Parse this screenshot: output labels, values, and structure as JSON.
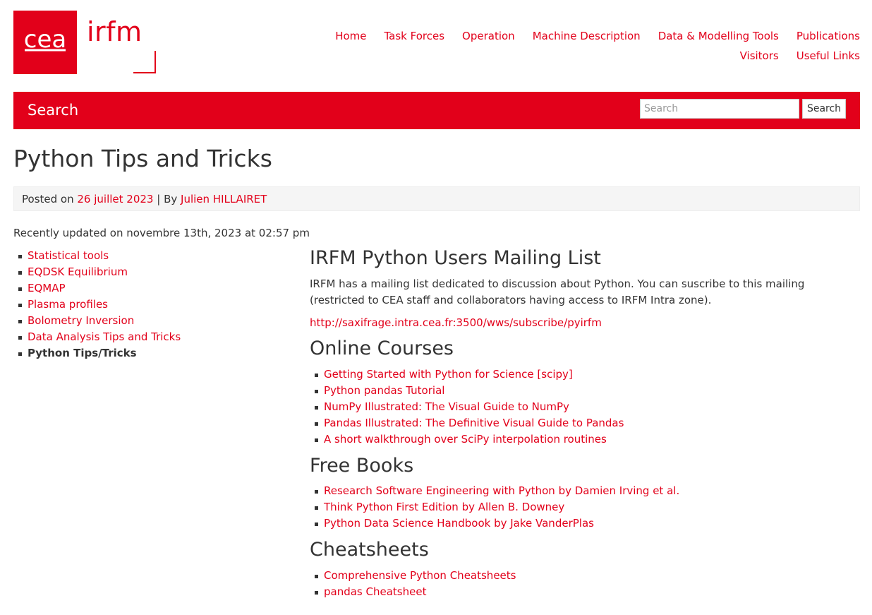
{
  "brand": {
    "logo_text": "cea",
    "site_name": "irfm",
    "accent_color": "#e2001a"
  },
  "nav": {
    "row1": [
      {
        "label": "Home"
      },
      {
        "label": "Task Forces"
      },
      {
        "label": "Operation"
      },
      {
        "label": "Machine Description"
      },
      {
        "label": "Data & Modelling Tools"
      },
      {
        "label": "Publications"
      }
    ],
    "row2": [
      {
        "label": "Visitors"
      },
      {
        "label": "Useful Links"
      }
    ]
  },
  "search": {
    "title": "Search",
    "placeholder": "Search",
    "button_label": "Search"
  },
  "post": {
    "title": "Python Tips and Tricks",
    "posted_on_label": "Posted on",
    "date": "26 juillet 2023",
    "separator": "| By",
    "author": "Julien HILLAIRET",
    "updated": "Recently updated on novembre 13th, 2023 at 02:57 pm"
  },
  "sidebar": {
    "items": [
      {
        "label": "Statistical tools"
      },
      {
        "label": "EQDSK Equilibrium"
      },
      {
        "label": "EQMAP"
      },
      {
        "label": "Plasma profiles"
      },
      {
        "label": "Bolometry Inversion"
      },
      {
        "label": "Data Analysis Tips and Tricks"
      },
      {
        "label": "Python Tips/Tricks"
      }
    ]
  },
  "content": {
    "mailing": {
      "heading": "IRFM Python Users Mailing List",
      "text": "IRFM has a mailing list dedicated to discussion about Python. You can suscribe to this mailing (restricted to CEA staff and collaborators having access to IRFM Intra zone).",
      "link": "http://saxifrage.intra.cea.fr:3500/wws/subscribe/pyirfm"
    },
    "courses": {
      "heading": "Online Courses",
      "items": [
        {
          "label": "Getting Started with Python for Science [scipy]"
        },
        {
          "label": "Python pandas Tutorial"
        },
        {
          "label": "NumPy Illustrated: The Visual Guide to NumPy"
        },
        {
          "label": "Pandas Illustrated: The Definitive Visual Guide to Pandas"
        },
        {
          "label": "A short walkthrough over SciPy interpolation routines"
        }
      ]
    },
    "books": {
      "heading": "Free Books",
      "items": [
        {
          "label": "Research Software Engineering with Python by Damien Irving et al."
        },
        {
          "label": "Think Python First Edition by Allen B. Downey"
        },
        {
          "label": "Python Data Science Handbook by Jake VanderPlas"
        }
      ]
    },
    "cheatsheets": {
      "heading": "Cheatsheets",
      "items": [
        {
          "label": "Comprehensive Python Cheatsheets"
        },
        {
          "label": "pandas Cheatsheet"
        }
      ]
    }
  }
}
